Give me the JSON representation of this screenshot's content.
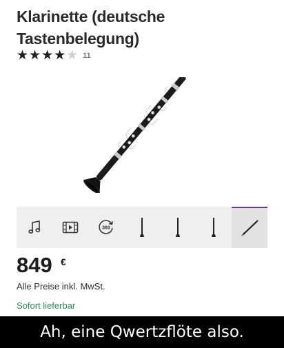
{
  "product": {
    "title": "Klarinette (deutsche Tastenbelegung)",
    "rating_value": 4,
    "rating_max": 5,
    "rating_stars": "★★★★★",
    "review_count": "11"
  },
  "gallery": {
    "thumbnails": [
      {
        "icon": "music-note-icon"
      },
      {
        "icon": "video-icon"
      },
      {
        "icon": "360-view-icon"
      },
      {
        "icon": "clarinet-vertical-thumbnail"
      },
      {
        "icon": "clarinet-vertical-thumbnail"
      },
      {
        "icon": "clarinet-vertical-thumbnail"
      },
      {
        "icon": "clarinet-diagonal-thumbnail",
        "selected": true
      }
    ],
    "view_360_label": "360"
  },
  "pricing": {
    "price": "849",
    "currency": "€",
    "vat_note": "Alle Preise inkl. MwSt.",
    "availability": "Sofort lieferbar"
  },
  "caption": {
    "text": "Ah, eine Qwertzflöte also."
  },
  "colors": {
    "availability": "#2e8b57",
    "selected_accent": "#6a2fb8",
    "thumb_bar_bg": "#efefef"
  }
}
